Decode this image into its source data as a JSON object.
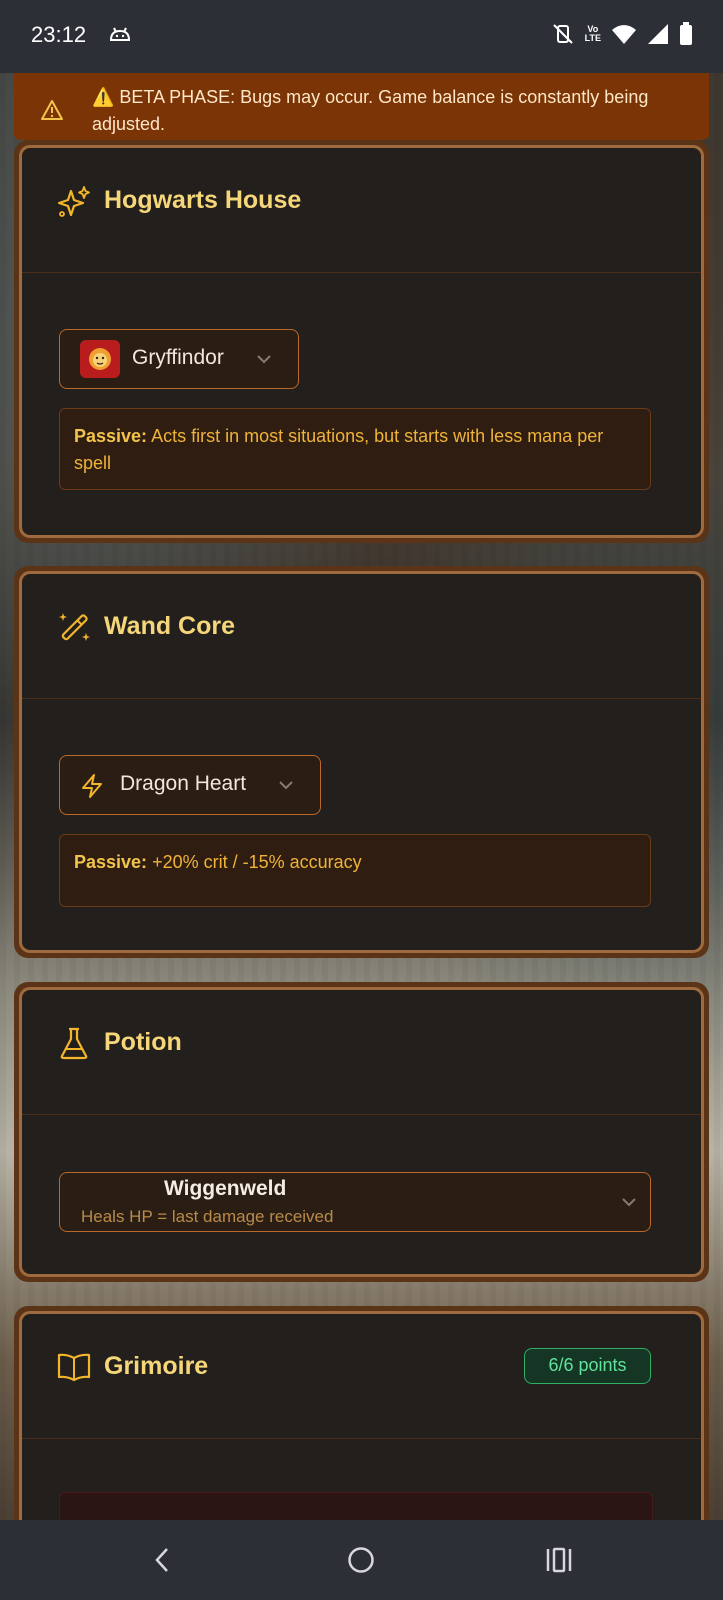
{
  "status_bar": {
    "time": "23:12",
    "lte_top": "Vo",
    "lte_bottom": "LTE"
  },
  "banner": {
    "text": "⚠️ BETA PHASE: Bugs may occur. Game balance is constantly being adjusted."
  },
  "house_card": {
    "title": "Hogwarts House",
    "icon": "sparkles-icon",
    "selected": "Gryffindor",
    "passive_label": "Passive:",
    "passive_text": " Acts first in most situations, but starts with less mana per spell"
  },
  "wand_card": {
    "title": "Wand Core",
    "icon": "magic-wand-icon",
    "selected": "Dragon Heart",
    "passive_label": "Passive:",
    "passive_text": " +20% crit / -15% accuracy"
  },
  "potion_card": {
    "title": "Potion",
    "icon": "flask-icon",
    "selected": "Wiggenweld",
    "description": "Heals HP = last damage received"
  },
  "grimoire_card": {
    "title": "Grimoire",
    "icon": "book-icon",
    "points": "6/6 points"
  },
  "colors": {
    "accent_gold": "#f5d77a",
    "passive_text": "#f0b33a",
    "border_brown": "#a06a3f",
    "banner_bg": "#7a3406",
    "success_green": "#5fe39a"
  }
}
